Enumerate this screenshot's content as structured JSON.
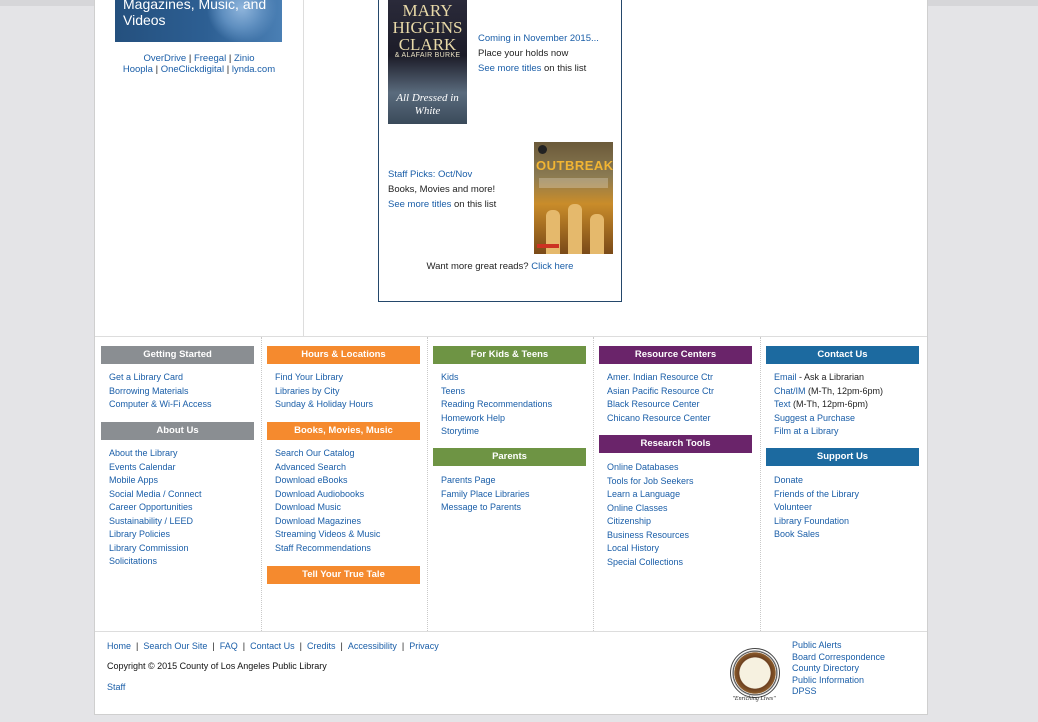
{
  "colors": {
    "getting_started": "#8a8e92",
    "hours": "#f58a2e",
    "kids": "#6e9444",
    "resource": "#6a246a",
    "contact": "#1c6aa0"
  },
  "promo": {
    "banner_text": "Magazines, Music, and Videos",
    "links_row1": [
      "OverDrive",
      "Freegal",
      "Zinio"
    ],
    "links_row2": [
      "Hoopla",
      "OneClickdigital",
      "lynda.com"
    ]
  },
  "reads": {
    "cover1": {
      "line1": "MARY HIGGINS CLARK",
      "line2": "& ALAFAIR BURKE",
      "line3": "All Dressed in White"
    },
    "item1": {
      "link": "Coming in November 2015...",
      "line2": "Place your holds now",
      "see_more": "See more titles",
      "suffix": " on this list"
    },
    "cover2": {
      "title": "OUTBREAK"
    },
    "item2": {
      "link": "Staff Picks: Oct/Nov",
      "line2": "Books, Movies and more!",
      "see_more": "See more titles",
      "suffix": " on this list"
    },
    "footer": {
      "text": "Want more great reads? ",
      "link": "Click here"
    }
  },
  "nav": {
    "getting_started": {
      "title": "Getting Started",
      "items": [
        "Get a Library Card",
        "Borrowing Materials",
        "Computer & Wi-Fi Access"
      ]
    },
    "about_us": {
      "title": "About Us",
      "items": [
        "About the Library",
        "Events Calendar",
        "Mobile Apps",
        "Social Media / Connect",
        "Career Opportunities",
        "Sustainability / LEED",
        "Library Policies",
        "Library Commission",
        "Solicitations"
      ]
    },
    "hours": {
      "title": "Hours & Locations",
      "items": [
        "Find Your Library",
        "Libraries by City",
        "Sunday & Holiday Hours"
      ]
    },
    "books": {
      "title": "Books, Movies, Music",
      "items": [
        "Search Our Catalog",
        "Advanced Search",
        "Download eBooks",
        "Download Audiobooks",
        "Download Music",
        "Download Magazines",
        "Streaming Videos & Music",
        "Staff Recommendations"
      ]
    },
    "true_tale": {
      "title": "Tell Your True Tale"
    },
    "kids": {
      "title": "For Kids & Teens",
      "items": [
        "Kids",
        "Teens",
        "Reading Recommendations",
        "Homework Help",
        "Storytime"
      ]
    },
    "parents": {
      "title": "Parents",
      "items": [
        "Parents Page",
        "Family Place Libraries",
        "Message to Parents"
      ]
    },
    "resource": {
      "title": "Resource Centers",
      "items": [
        "Amer. Indian Resource Ctr",
        "Asian Pacific Resource Ctr",
        "Black Resource Center",
        "Chicano Resource Center"
      ]
    },
    "research": {
      "title": "Research Tools",
      "items": [
        "Online Databases",
        "Tools for Job Seekers",
        "Learn a Language",
        "Online Classes",
        "Citizenship",
        "Business Resources",
        "Local History",
        "Special Collections"
      ]
    },
    "contact": {
      "title": "Contact Us",
      "email_link": "Email",
      "email_suffix": " - Ask a Librarian",
      "chat_link": "Chat/IM",
      "chat_suffix": " (M-Th, 12pm-6pm)",
      "text_link": "Text",
      "text_suffix": " (M-Th, 12pm-6pm)",
      "items": [
        "Suggest a Purchase",
        "Film at a Library"
      ]
    },
    "support": {
      "title": "Support Us",
      "items": [
        "Donate",
        "Friends of the Library",
        "Volunteer",
        "Library Foundation",
        "Book Sales"
      ]
    }
  },
  "bottom": {
    "links": [
      "Home",
      "Search Our Site",
      "FAQ",
      "Contact Us",
      "Credits",
      "Accessibility",
      "Privacy"
    ],
    "copyright": "Copyright © 2015 County of Los Angeles Public Library",
    "staff": "Staff",
    "seal_motto": "\"Enriching Lives\"",
    "right_links": [
      "Public Alerts",
      "Board Correspondence",
      "County Directory",
      "Public Information",
      "DPSS"
    ]
  }
}
